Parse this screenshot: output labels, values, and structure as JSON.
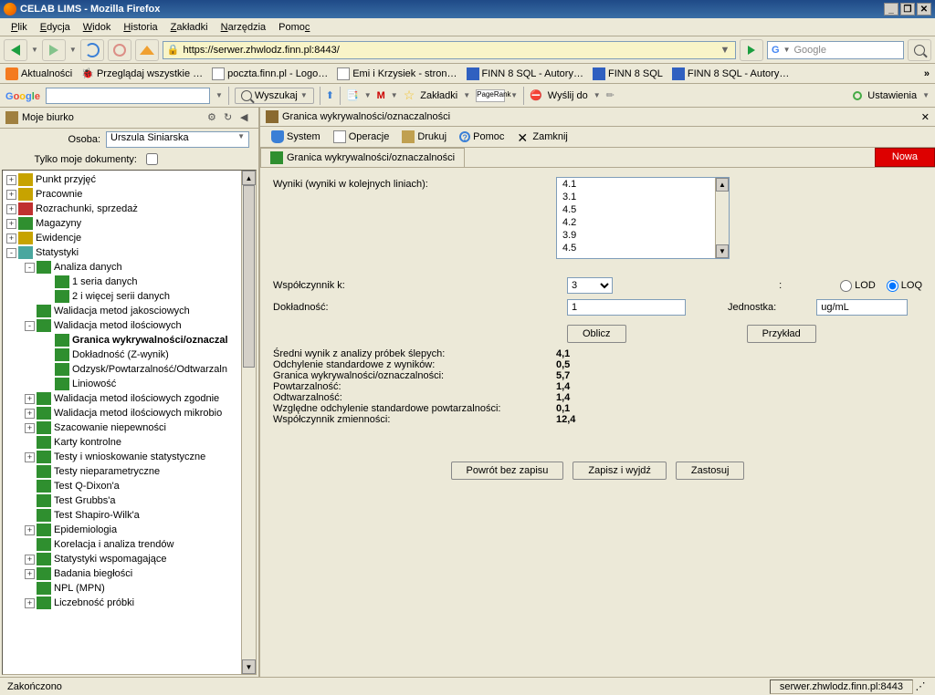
{
  "window": {
    "title": "CELAB LIMS - Mozilla Firefox"
  },
  "menubar": [
    "Plik",
    "Edycja",
    "Widok",
    "Historia",
    "Zakładki",
    "Narzędzia",
    "Pomoc"
  ],
  "url": "https://serwer.zhwlodz.finn.pl:8443/",
  "search_placeholder": "Google",
  "bookmarks": [
    "Aktualności",
    "Przeglądaj wszystkie …",
    "poczta.finn.pl - Logo…",
    "Emi i Krzysiek - stron…",
    "FINN 8 SQL - Autory…",
    "FINN 8 SQL",
    "FINN 8 SQL - Autory…"
  ],
  "googlebar": {
    "search_btn": "Wyszukaj",
    "bookmarks": "Zakładki",
    "send": "Wyślij do",
    "settings": "Ustawienia",
    "pagerank": "PageRank"
  },
  "left": {
    "header": "Moje biurko",
    "person_lbl": "Osoba:",
    "person_val": "Urszula Siniarska",
    "only_mine_lbl": "Tylko moje dokumenty:",
    "tree": [
      {
        "d": 0,
        "exp": "+",
        "ic": "yellow",
        "t": "Punkt przyjęć"
      },
      {
        "d": 0,
        "exp": "+",
        "ic": "yellow",
        "t": "Pracownie"
      },
      {
        "d": 0,
        "exp": "+",
        "ic": "red",
        "t": "Rozrachunki, sprzedaż"
      },
      {
        "d": 0,
        "exp": "+",
        "ic": "green",
        "t": "Magazyny"
      },
      {
        "d": 0,
        "exp": "+",
        "ic": "yellow",
        "t": "Ewidencje"
      },
      {
        "d": 0,
        "exp": "-",
        "ic": "teal",
        "t": "Statystyki"
      },
      {
        "d": 1,
        "exp": "-",
        "ic": "green",
        "t": "Analiza danych"
      },
      {
        "d": 2,
        "exp": "",
        "ic": "green",
        "t": "1 seria danych"
      },
      {
        "d": 2,
        "exp": "",
        "ic": "green",
        "t": "2 i więcej serii danych"
      },
      {
        "d": 1,
        "exp": "",
        "ic": "green",
        "t": "Walidacja metod jakosciowych"
      },
      {
        "d": 1,
        "exp": "-",
        "ic": "green",
        "t": "Walidacja metod ilościowych"
      },
      {
        "d": 2,
        "exp": "",
        "ic": "green",
        "t": "Granica wykrywalności/oznaczal",
        "b": 1
      },
      {
        "d": 2,
        "exp": "",
        "ic": "green",
        "t": "Dokładność (Z-wynik)"
      },
      {
        "d": 2,
        "exp": "",
        "ic": "green",
        "t": "Odzysk/Powtarzalność/Odtwarzaln"
      },
      {
        "d": 2,
        "exp": "",
        "ic": "green",
        "t": "Liniowość"
      },
      {
        "d": 1,
        "exp": "+",
        "ic": "green",
        "t": "Walidacja metod ilościowych zgodnie"
      },
      {
        "d": 1,
        "exp": "+",
        "ic": "green",
        "t": "Walidacja metod ilościowych mikrobio"
      },
      {
        "d": 1,
        "exp": "+",
        "ic": "green",
        "t": "Szacowanie niepewności"
      },
      {
        "d": 1,
        "exp": "",
        "ic": "green",
        "t": "Karty kontrolne"
      },
      {
        "d": 1,
        "exp": "+",
        "ic": "green",
        "t": "Testy i wnioskowanie statystyczne"
      },
      {
        "d": 1,
        "exp": "",
        "ic": "green",
        "t": "Testy nieparametryczne"
      },
      {
        "d": 1,
        "exp": "",
        "ic": "green",
        "t": "Test Q-Dixon'a"
      },
      {
        "d": 1,
        "exp": "",
        "ic": "green",
        "t": "Test Grubbs'a"
      },
      {
        "d": 1,
        "exp": "",
        "ic": "green",
        "t": "Test Shapiro-Wilk'a"
      },
      {
        "d": 1,
        "exp": "+",
        "ic": "green",
        "t": "Epidemiologia"
      },
      {
        "d": 1,
        "exp": "",
        "ic": "green",
        "t": "Korelacja i analiza trendów"
      },
      {
        "d": 1,
        "exp": "+",
        "ic": "green",
        "t": "Statystyki wspomagające"
      },
      {
        "d": 1,
        "exp": "+",
        "ic": "green",
        "t": "Badania biegłości"
      },
      {
        "d": 1,
        "exp": "",
        "ic": "green",
        "t": "NPL (MPN)"
      },
      {
        "d": 1,
        "exp": "+",
        "ic": "green",
        "t": "Liczebność próbki"
      }
    ]
  },
  "right": {
    "title": "Granica wykrywalności/oznaczalności",
    "toolbar": {
      "system": "System",
      "operacje": "Operacje",
      "drukuj": "Drukuj",
      "pomoc": "Pomoc",
      "zamknij": "Zamknij"
    },
    "tab": "Granica wykrywalności/oznaczalności",
    "nowa": "Nowa",
    "form": {
      "wyniki_lbl": "Wyniki (wyniki w kolejnych liniach):",
      "wyniki": [
        "4.1",
        "3.1",
        "4.5",
        "4.2",
        "3.9",
        "4.5"
      ],
      "wsp_lbl": "Współczynnik k:",
      "wsp_val": "3",
      "colon": ":",
      "lod": "LOD",
      "loq": "LOQ",
      "dokl_lbl": "Dokładność:",
      "dokl_val": "1",
      "jedn_lbl": "Jednostka:",
      "jedn_val": "ug/mL",
      "oblicz": "Oblicz",
      "przyklad": "Przykład"
    },
    "results": [
      {
        "l": "Średni wynik z analizy próbek ślepych:",
        "v": "4,1"
      },
      {
        "l": "Odchylenie standardowe z wyników:",
        "v": "0,5"
      },
      {
        "l": "Granica wykrywalności/oznaczalności:",
        "v": "5,7"
      },
      {
        "l": "Powtarzalność:",
        "v": "1,4"
      },
      {
        "l": "Odtwarzalność:",
        "v": "1,4"
      },
      {
        "l": "Względne odchylenie standardowe powtarzalności:",
        "v": "0,1"
      },
      {
        "l": "Współczynnik zmienności:",
        "v": "12,4"
      }
    ],
    "actions": {
      "powrot": "Powrót bez zapisu",
      "zapisz": "Zapisz i wyjdź",
      "zastosuj": "Zastosuj"
    }
  },
  "status": {
    "left": "Zakończono",
    "right": "serwer.zhwlodz.finn.pl:8443"
  }
}
